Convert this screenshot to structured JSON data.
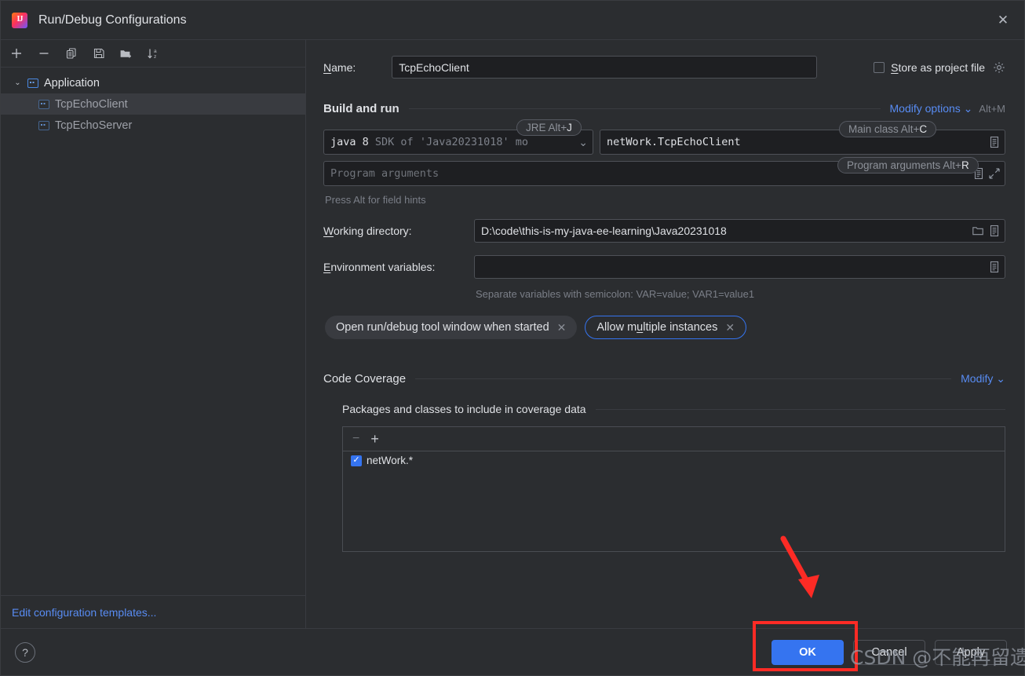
{
  "window": {
    "title": "Run/Debug Configurations",
    "app_icon": "intellij-idea-icon",
    "close_icon": "close-icon"
  },
  "sidebar": {
    "toolbar": [
      {
        "name": "add-configuration-button",
        "glyph": "+"
      },
      {
        "name": "remove-configuration-button",
        "glyph": "−"
      },
      {
        "name": "copy-configuration-button",
        "glyph": "copy-icon"
      },
      {
        "name": "save-configuration-button",
        "glyph": "save-icon"
      },
      {
        "name": "move-into-folder-button",
        "glyph": "folder-add-icon"
      },
      {
        "name": "sort-configurations-button",
        "glyph": "sort-az-icon"
      }
    ],
    "tree": {
      "group_label": "Application",
      "items": [
        {
          "label": "TcpEchoClient",
          "selected": true
        },
        {
          "label": "TcpEchoServer",
          "selected": false
        }
      ]
    },
    "footer_link": "Edit configuration templates..."
  },
  "form": {
    "name_label": "Name:",
    "name_label_mnemonic": "N",
    "name_value": "TcpEchoClient",
    "store_as_project_file_label": "Store as project file",
    "store_as_project_file_checked": false,
    "store_gear_icon": "gear-icon",
    "build_and_run": {
      "title": "Build and run",
      "modify_options_label": "Modify options",
      "modify_options_shortcut": "Alt+M",
      "jre_hint": "JRE Alt+J",
      "jre_hint_key": "J",
      "main_class_hint": "Main class Alt+C",
      "main_class_hint_key": "C",
      "program_arguments_hint": "Program arguments Alt+R",
      "program_arguments_hint_key": "R",
      "jre_value_bold": "java 8",
      "jre_value_rest": "SDK of 'Java20231018' mo",
      "main_class_value": "netWork.TcpEchoClient",
      "program_arguments_placeholder": "Program arguments",
      "field_hint": "Press Alt for field hints"
    },
    "working_directory_label": "Working directory:",
    "working_directory_mnemonic": "W",
    "working_directory_value": "D:\\code\\this-is-my-java-ee-learning\\Java20231018",
    "environment_variables_label": "Environment variables:",
    "environment_variables_mnemonic": "E",
    "environment_variables_value": "",
    "environment_hint": "Separate variables with semicolon: VAR=value; VAR1=value1",
    "chips": [
      {
        "label": "Open run/debug tool window when started",
        "focused": false,
        "mnemonic": ""
      },
      {
        "label": "Allow multiple instances",
        "focused": true,
        "mnemonic": "u"
      }
    ],
    "code_coverage": {
      "title": "Code Coverage",
      "modify_label": "Modify",
      "subtitle": "Packages and classes to include in coverage data",
      "toolbar": [
        {
          "name": "remove-package-button",
          "glyph": "−"
        },
        {
          "name": "add-package-button",
          "glyph": "+"
        }
      ],
      "entries": [
        {
          "label": "netWork.*",
          "checked": true
        }
      ]
    }
  },
  "footer": {
    "help_label": "?",
    "buttons": [
      {
        "label": "OK",
        "primary": true,
        "name": "ok-button"
      },
      {
        "label": "Cancel",
        "primary": false,
        "name": "cancel-button"
      },
      {
        "label": "Apply",
        "primary": false,
        "name": "apply-button"
      }
    ]
  },
  "annotations": {
    "highlight_color": "#fd2b25",
    "watermark_text": "CSDN @不能再留遗憾了"
  }
}
